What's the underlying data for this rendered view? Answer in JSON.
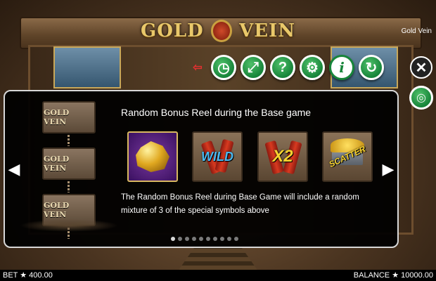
{
  "game": {
    "logo_left": "GOLD",
    "logo_right": "VEIN",
    "title": "Gold Vein"
  },
  "toolbar": {
    "exit_icon": "exit-icon",
    "buttons": [
      {
        "name": "history",
        "icon": "clock-icon",
        "glyph": "◷"
      },
      {
        "name": "fullscreen",
        "icon": "fullscreen-icon",
        "glyph": "⤢"
      },
      {
        "name": "help",
        "icon": "question-icon",
        "glyph": "?"
      },
      {
        "name": "settings",
        "icon": "gear-icon",
        "glyph": "⚙"
      },
      {
        "name": "info",
        "icon": "info-icon",
        "glyph": "i"
      },
      {
        "name": "autoplay",
        "icon": "autoplay-icon",
        "glyph": "↻"
      }
    ],
    "close_glyph": "✕",
    "coins_glyph": "◎"
  },
  "help_panel": {
    "heading": "Random Bonus Reel during the Base game",
    "description": "The Random Bonus Reel during Base Game will include a random mixture of 3 of the special symbols above",
    "chest_label": "GOLD VEIN",
    "symbols": {
      "wild": "WILD",
      "x2": "X2",
      "scatter": "SCATTER"
    },
    "page_count": 10,
    "active_page": 1,
    "prev_glyph": "◀",
    "next_glyph": "▶"
  },
  "status": {
    "bet_label": "BET ★ 400.00",
    "balance_label": "BALANCE ★ 10000.00"
  },
  "colors": {
    "accent_green": "#17853a",
    "gold": "#e9c86a",
    "panel_bg": "#000000"
  }
}
